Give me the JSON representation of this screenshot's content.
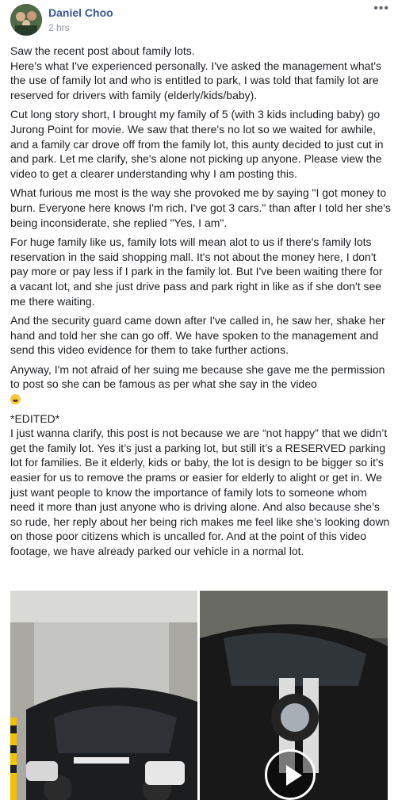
{
  "post": {
    "author": "Daniel Choo",
    "time": "2 hrs",
    "more_label": "•••",
    "paragraphs": [
      "Saw the recent post about family lots.\nHere's what I've experienced personally. I've asked the management what's the use of family lot and who is entitled to park, I was told that family lot are reserved for drivers with family (elderly/kids/baby).",
      "Cut long story short, I brought my family of 5 (with 3 kids including baby) go Jurong Point for movie. We saw that there's no lot so we waited for awhile, and a family car drove off from the family lot, this aunty decided to just cut in and park. Let me clarify, she's alone not picking up anyone. Please view the video to get a clearer understanding why I am posting this.",
      "What furious me most is the way she provoked me by saying \"I got money to burn. Everyone here knows I'm rich, I've got 3 cars.\" than after I told her she's being inconsiderate, she replied \"Yes, I am\".",
      "For huge family like us, family lots will mean alot to us if there's family lots reservation in the said shopping mall. It's not about the money here, I don't pay more or pay less if I park in the family lot. But I've been waiting there for a vacant lot, and she just drive pass and park right in like as if she don't see me there waiting.",
      "And the security guard came down after I've called in, he saw her, shake her hand and told her she can go off. We have spoken to the management and send this video evidence for them to take further actions.",
      "Anyway, I'm not afraid of her suing me because she gave me the permission to post so she can be famous as per what she say in the video",
      "*EDITED*\nI just wanna clarify, this post is not because we are “not happy” that we didn’t get the family lot. Yes it’s just a parking lot, but still it’s a RESERVED parking lot for families. Be it elderly, kids or baby, the lot is design to be bigger so it’s easier for us to remove the prams or easier for elderly to alight or get in. We just want people to know the importance of family lots to someone whom need it more than just anyone who is driving alone. And also because she’s so rude, her reply about her being rich makes me feel like she’s looking down on those poor citizens which is uncalled for. And at the point of this video footage, we have already parked our vehicle in a normal lot."
    ],
    "emoji": "grinning-sweat-emoji",
    "colors": {
      "author": "#385898",
      "meta": "#90949c",
      "text": "#1c1e21"
    }
  },
  "media": {
    "left_photo": "car-parked-in-lot",
    "right_video": "car-video-thumbnail",
    "play_icon": "play-icon"
  }
}
